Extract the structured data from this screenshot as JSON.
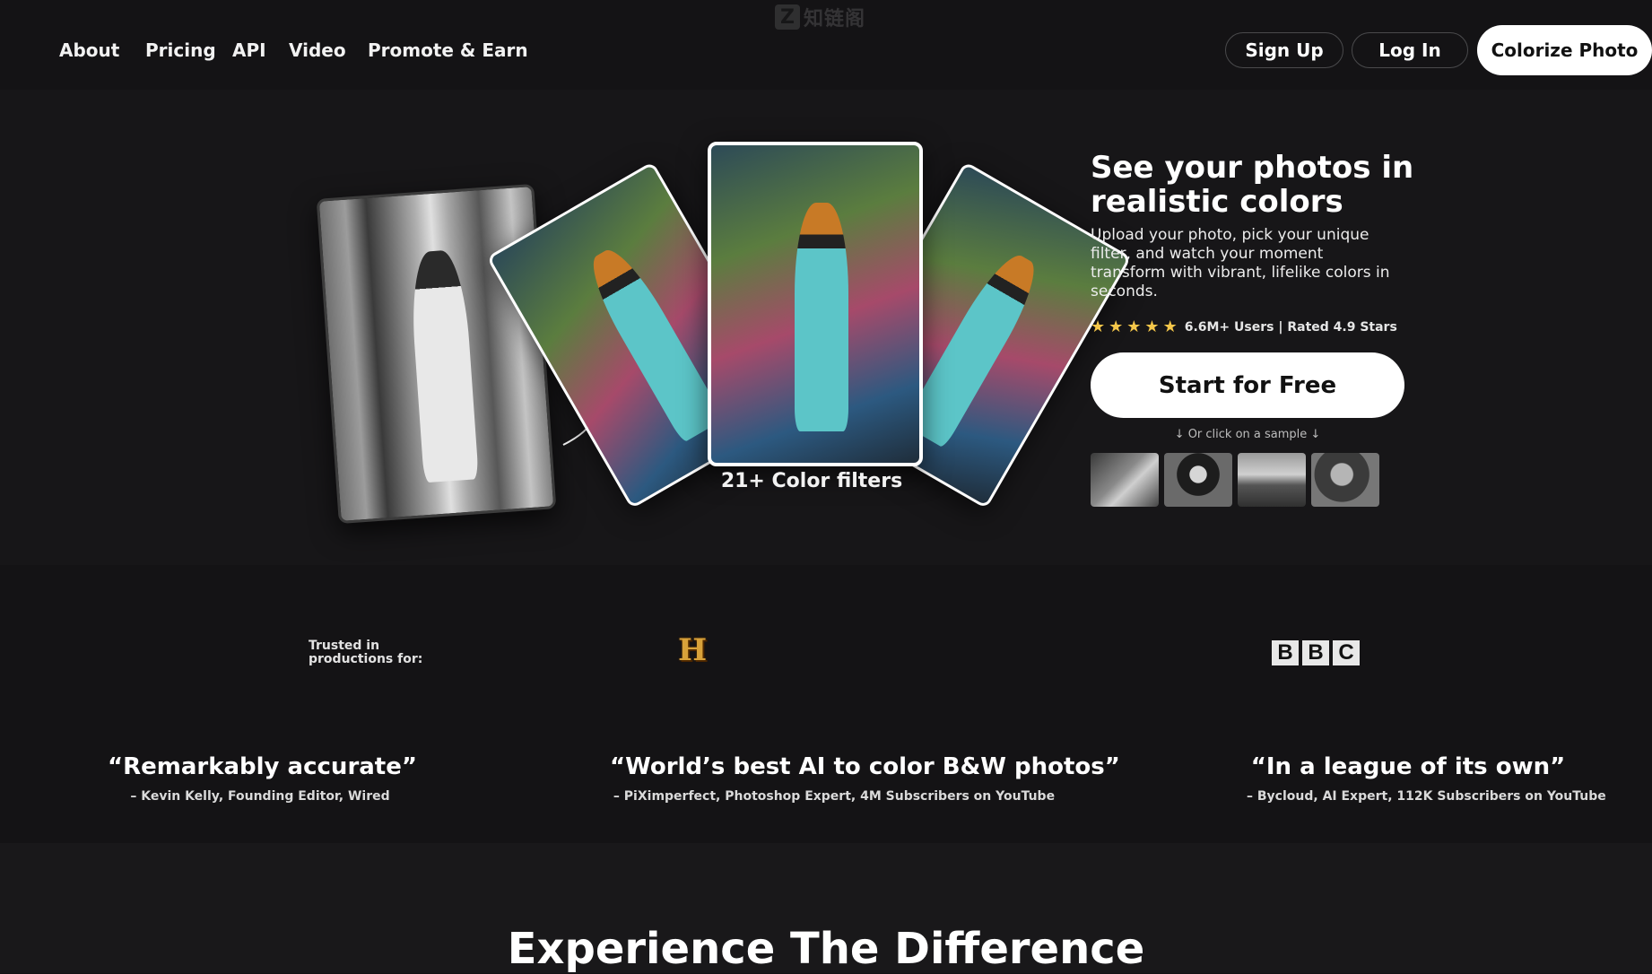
{
  "watermark": {
    "letter": "Z",
    "text": "知链阁"
  },
  "nav": {
    "links": [
      "About",
      "Pricing",
      "API",
      "Video",
      "Promote & Earn"
    ],
    "sign_up": "Sign Up",
    "log_in": "Log In",
    "colorize": "Colorize Photo"
  },
  "hero": {
    "filters_label": "21+ Color filters",
    "title": "See your photos in realistic colors",
    "subtitle": "Upload your photo, pick your unique filter, and watch your moment transform with vibrant, lifelike colors in seconds.",
    "rating_stars": 5,
    "rating_text": "6.6M+ Users | Rated 4.9 Stars",
    "cta": "Start for Free",
    "sample_hint": "↓ Or click on a sample ↓"
  },
  "trusted": {
    "label": "Trusted in productions for:",
    "logos": [
      "history-logo",
      "bbc-logo"
    ],
    "history_letter": "H",
    "bbc_letters": [
      "B",
      "B",
      "C"
    ]
  },
  "quotes": [
    {
      "text": "“Remarkably accurate”",
      "by": "– Kevin Kelly, Founding Editor, Wired"
    },
    {
      "text": "“World’s best AI to color B&W photos”",
      "by": "– PiXimperfect, Photoshop Expert, 4M Subscribers on YouTube"
    },
    {
      "text": "“In a league of its own”",
      "by": "– Bycloud, AI Expert, 112K Subscribers on YouTube"
    }
  ],
  "section": {
    "title": "Experience The Difference"
  },
  "colors": {
    "background": "#141315",
    "star": "#f5c74a",
    "history": "#d9a23a"
  }
}
